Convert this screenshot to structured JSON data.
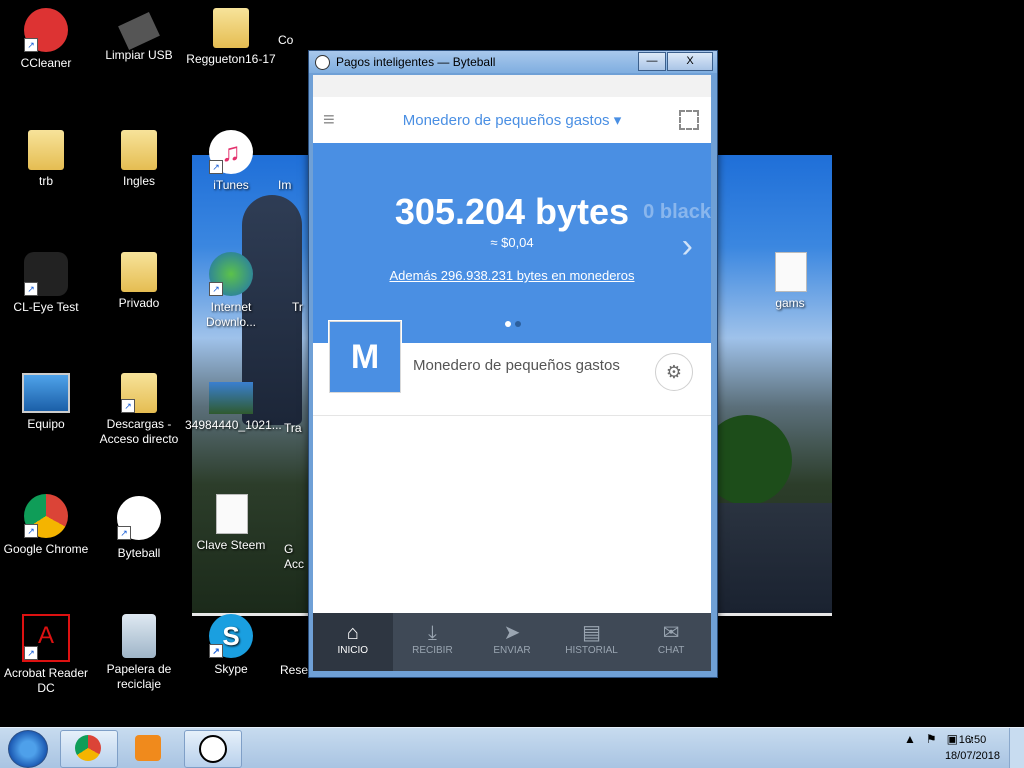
{
  "desktop": {
    "icons": [
      {
        "label": "CCleaner"
      },
      {
        "label": "Limpiar USB"
      },
      {
        "label": "Reggueton16-17"
      },
      {
        "label": "Co"
      },
      {
        "label": "trb"
      },
      {
        "label": "Ingles"
      },
      {
        "label": "iTunes"
      },
      {
        "label": "Im"
      },
      {
        "label": "CL-Eye Test"
      },
      {
        "label": "Privado"
      },
      {
        "label": "Internet Downlo..."
      },
      {
        "label": "Tr"
      },
      {
        "label": "Equipo"
      },
      {
        "label": "Descargas - Acceso directo"
      },
      {
        "label": "34984440_1021..."
      },
      {
        "label": "Tra"
      },
      {
        "label": "Google Chrome"
      },
      {
        "label": "Byteball"
      },
      {
        "label": "Clave Steem"
      },
      {
        "label": "G Acc"
      },
      {
        "label": "Acrobat Reader DC"
      },
      {
        "label": "Papelera de reciclaje"
      },
      {
        "label": "Skype"
      },
      {
        "label": "Resen"
      },
      {
        "label": "gams"
      }
    ]
  },
  "window": {
    "title": "Pagos inteligentes — Byteball",
    "minimize": "—",
    "close": "X"
  },
  "app": {
    "header": {
      "menu_icon": "≡",
      "wallet_name": "Monedero de pequeños gastos ▾"
    },
    "balance": {
      "amount": "305.204 bytes",
      "fiat": "≈ $0,04",
      "more": "Además 296.938.231 bytes en monederos",
      "next_peek": "0 black",
      "chevron": "›"
    },
    "wallet": {
      "avatar_letter": "M",
      "name": "Monedero de pequeños gastos"
    },
    "tabs": [
      {
        "label": "INICIO",
        "icon": "home-icon",
        "glyph": "⌂"
      },
      {
        "label": "RECIBIR",
        "icon": "receive-icon",
        "glyph": "⤓"
      },
      {
        "label": "ENVIAR",
        "icon": "send-icon",
        "glyph": "➤"
      },
      {
        "label": "HISTORIAL",
        "icon": "history-icon",
        "glyph": "▤"
      },
      {
        "label": "CHAT",
        "icon": "chat-icon",
        "glyph": "✉"
      }
    ]
  },
  "taskbar": {
    "tray_up": "▲",
    "time": "16:50",
    "date": "18/07/2018"
  },
  "colors": {
    "accent": "#4a8fe3",
    "tabbar": "#3f4956"
  }
}
